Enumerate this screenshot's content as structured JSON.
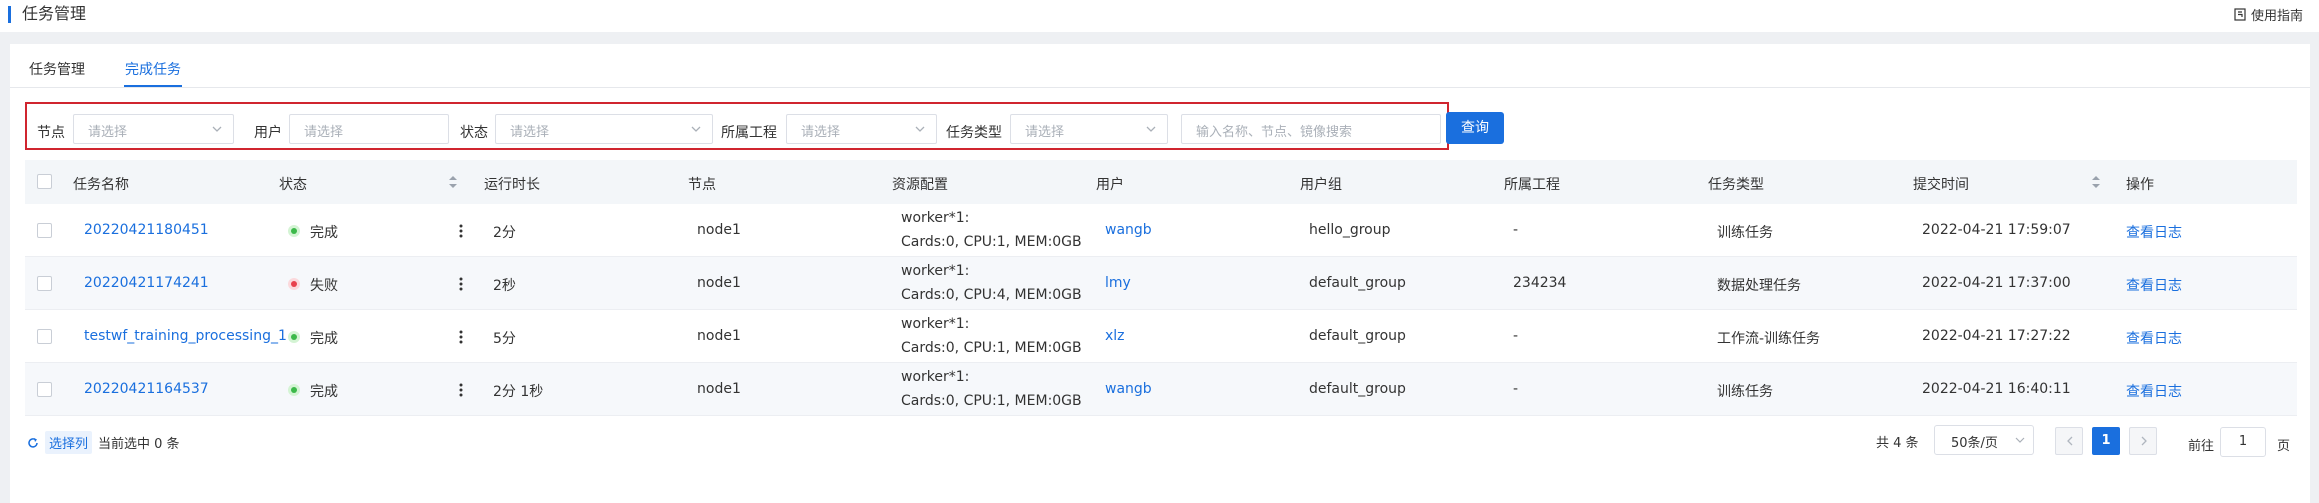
{
  "header": {
    "title": "任务管理",
    "guide_label": "使用指南",
    "guide_icon": "doc-icon"
  },
  "tabs": [
    {
      "label": "任务管理",
      "active": false
    },
    {
      "label": "完成任务",
      "active": true
    }
  ],
  "filters": {
    "node": {
      "label": "节点",
      "placeholder": "请选择"
    },
    "user": {
      "label": "用户",
      "placeholder": "请选择"
    },
    "status": {
      "label": "状态",
      "placeholder": "请选择"
    },
    "project": {
      "label": "所属工程",
      "placeholder": "请选择"
    },
    "task_type": {
      "label": "任务类型",
      "placeholder": "请选择"
    },
    "search": {
      "placeholder": "输入名称、节点、镜像搜索"
    },
    "query_label": "查询"
  },
  "table": {
    "columns": [
      "任务名称",
      "状态",
      "运行时长",
      "节点",
      "资源配置",
      "用户",
      "用户组",
      "所属工程",
      "任务类型",
      "提交时间",
      "操作"
    ],
    "rows": [
      {
        "name": "20220421180451",
        "status": "完成",
        "status_kind": "ok",
        "duration": "2分",
        "node": "node1",
        "res1": "worker*1:",
        "res2": "Cards:0, CPU:1, MEM:0GB",
        "user": "wangb",
        "group": "hello_group",
        "project": "-",
        "type": "训练任务",
        "time": "2022-04-21 17:59:07",
        "action": "查看日志"
      },
      {
        "name": "20220421174241",
        "status": "失败",
        "status_kind": "fail",
        "duration": "2秒",
        "node": "node1",
        "res1": "worker*1:",
        "res2": "Cards:0, CPU:4, MEM:0GB",
        "user": "lmy",
        "group": "default_group",
        "project": "234234",
        "type": "数据处理任务",
        "time": "2022-04-21 17:37:00",
        "action": "查看日志"
      },
      {
        "name": "testwf_training_processing_1",
        "status": "完成",
        "status_kind": "ok",
        "duration": "5分",
        "node": "node1",
        "res1": "worker*1:",
        "res2": "Cards:0, CPU:1, MEM:0GB",
        "user": "xlz",
        "group": "default_group",
        "project": "-",
        "type": "工作流-训练任务",
        "time": "2022-04-21 17:27:22",
        "action": "查看日志"
      },
      {
        "name": "20220421164537",
        "status": "完成",
        "status_kind": "ok",
        "duration": "2分 1秒",
        "node": "node1",
        "res1": "worker*1:",
        "res2": "Cards:0, CPU:1, MEM:0GB",
        "user": "wangb",
        "group": "default_group",
        "project": "-",
        "type": "训练任务",
        "time": "2022-04-21 16:40:11",
        "action": "查看日志"
      }
    ]
  },
  "footer": {
    "select_columns": "选择列",
    "selected_text": "当前选中 0 条",
    "total": "共 4 条",
    "page_size": "50条/页",
    "current_page": "1",
    "goto_prefix": "前往",
    "goto_value": "1",
    "goto_suffix": "页"
  },
  "colors": {
    "accent": "#1a6fde",
    "highlight_border": "#d0252f",
    "ok": "#3cb94a",
    "fail": "#e8404c"
  }
}
